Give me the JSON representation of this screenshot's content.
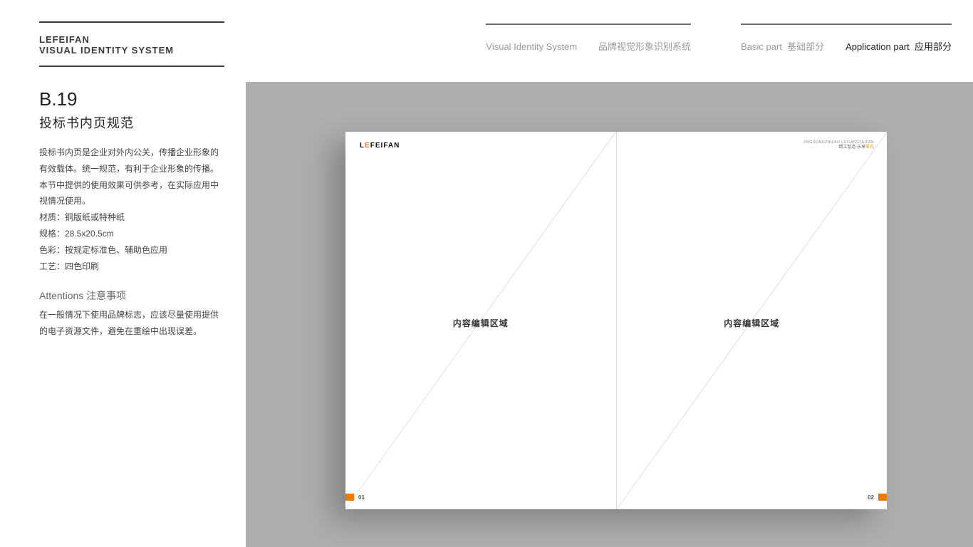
{
  "nav": {
    "group1": {
      "en": "Visual Identity System",
      "cn": "品牌视觉形象识别系统"
    },
    "group2": {
      "basic": {
        "en": "Basic part",
        "cn": "基础部分"
      },
      "app": {
        "en": "Application part",
        "cn": "应用部分"
      }
    }
  },
  "sidebar": {
    "brand_line1": "LEFEIFAN",
    "brand_line2": "VISUAL IDENTITY SYSTEM",
    "code": "B.19",
    "title_cn": "投标书内页规范",
    "para": "投标书内页是企业对外内公关，传播企业形象的有效载体。统一规范，有利于企业形象的传播。本节中提供的使用效果可供参考，在实际应用中视情况使用。",
    "spec_material": "材质：铜版纸或特种纸",
    "spec_size": "规格：28.5x20.5cm",
    "spec_color": "色彩：按规定标准色、辅助色应用",
    "spec_craft": "工艺：四色印刷",
    "att_head": "Attentions 注意事项",
    "att_body": "在一般情况下使用品牌标志，应该尽量使用提供的电子资源文件，避免在重绘中出现误差。"
  },
  "spread": {
    "logo_pre": "L",
    "logo_accent": "E",
    "logo_post": "FEIFAN",
    "pr_line1": "JINGGONGZHIZAO LEXIANGFEIFAN",
    "pr_line2a": "精工智造 乐享",
    "pr_line2b": "非凡",
    "content_label": "内容编辑区域",
    "page_left_no": "01",
    "page_right_no": "02"
  }
}
